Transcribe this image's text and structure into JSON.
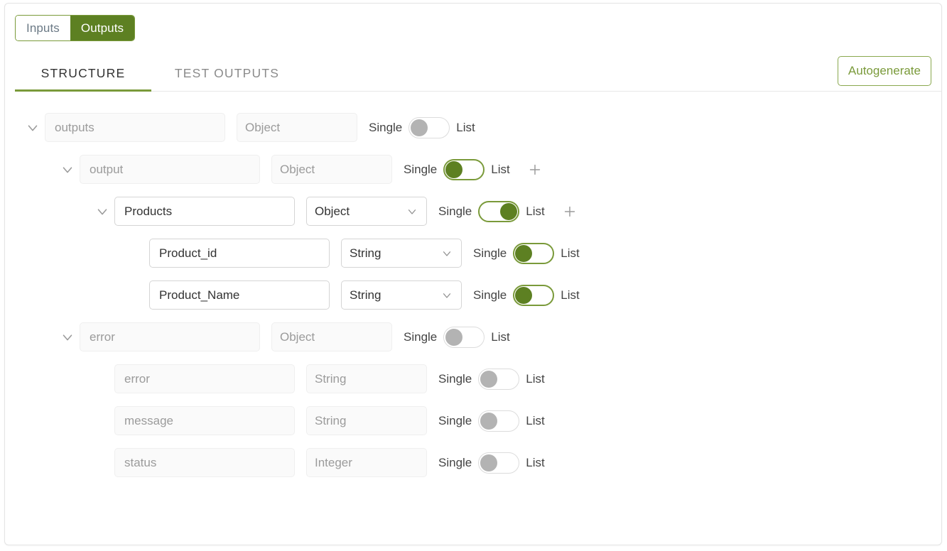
{
  "segmented": {
    "items": [
      {
        "label": "Inputs",
        "active": false
      },
      {
        "label": "Outputs",
        "active": true
      }
    ]
  },
  "tabs": {
    "items": [
      {
        "label": "STRUCTURE",
        "active": true
      },
      {
        "label": "TEST OUTPUTS",
        "active": false
      }
    ]
  },
  "toolbar": {
    "autogenerate_label": "Autogenerate"
  },
  "labels": {
    "single": "Single",
    "list": "List"
  },
  "colors": {
    "accent_green": "#5d8022",
    "border_green": "#7a9a3a",
    "knob_gray": "#b3b3b3",
    "text_dark": "#333333",
    "text_placeholder": "#9b9b9b"
  },
  "tree": {
    "rows": [
      {
        "name": "outputs",
        "type": "Object",
        "depth": 0,
        "enabled": false,
        "expandable": true,
        "has_chevron": false,
        "toggle_state": "off",
        "toggle_position": "left",
        "has_add": false
      },
      {
        "name": "output",
        "type": "Object",
        "depth": 1,
        "enabled": false,
        "expandable": true,
        "has_chevron": false,
        "toggle_state": "on",
        "toggle_position": "left",
        "has_add": true
      },
      {
        "name": "Products",
        "type": "Object",
        "depth": 2,
        "enabled": true,
        "expandable": true,
        "has_chevron": true,
        "toggle_state": "on",
        "toggle_position": "right",
        "has_add": true
      },
      {
        "name": "Product_id",
        "type": "String",
        "depth": 3,
        "enabled": true,
        "expandable": false,
        "has_chevron": true,
        "toggle_state": "on",
        "toggle_position": "left",
        "has_add": false
      },
      {
        "name": "Product_Name",
        "type": "String",
        "depth": 3,
        "enabled": true,
        "expandable": false,
        "has_chevron": true,
        "toggle_state": "on",
        "toggle_position": "left",
        "has_add": false
      },
      {
        "name": "error",
        "type": "Object",
        "depth": 1,
        "enabled": false,
        "expandable": true,
        "has_chevron": false,
        "toggle_state": "off",
        "toggle_position": "left",
        "has_add": false
      },
      {
        "name": "error",
        "type": "String",
        "depth": 2,
        "enabled": false,
        "expandable": false,
        "has_chevron": false,
        "toggle_state": "off",
        "toggle_position": "left",
        "has_add": false
      },
      {
        "name": "message",
        "type": "String",
        "depth": 2,
        "enabled": false,
        "expandable": false,
        "has_chevron": false,
        "toggle_state": "off",
        "toggle_position": "left",
        "has_add": false
      },
      {
        "name": "status",
        "type": "Integer",
        "depth": 2,
        "enabled": false,
        "expandable": false,
        "has_chevron": false,
        "toggle_state": "off",
        "toggle_position": "left",
        "has_add": false
      }
    ]
  }
}
